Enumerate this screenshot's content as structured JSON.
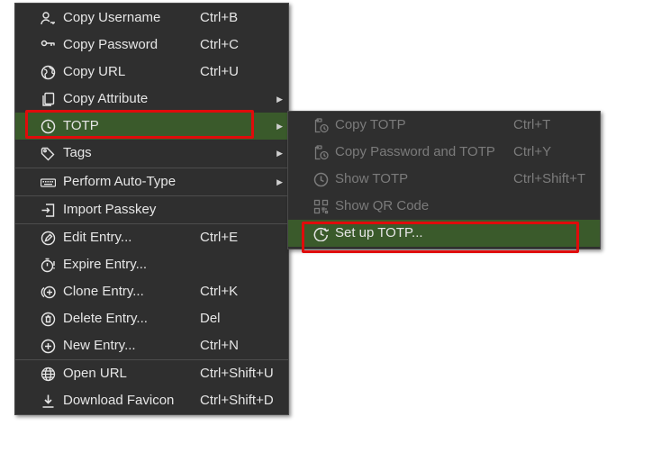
{
  "main_menu": {
    "items": [
      {
        "label": "Copy Username",
        "shortcut": "Ctrl+B",
        "icon": "user-key-icon"
      },
      {
        "label": "Copy Password",
        "shortcut": "Ctrl+C",
        "icon": "key-icon"
      },
      {
        "label": "Copy URL",
        "shortcut": "Ctrl+U",
        "icon": "globe-icon"
      },
      {
        "label": "Copy Attribute",
        "shortcut": "",
        "icon": "copy-icon"
      },
      {
        "label": "TOTP",
        "shortcut": "",
        "icon": "clock-icon"
      },
      {
        "label": "Tags",
        "shortcut": "",
        "icon": "tag-icon"
      },
      {
        "label": "Perform Auto-Type",
        "shortcut": "",
        "icon": "keyboard-icon"
      },
      {
        "label": "Import Passkey",
        "shortcut": "",
        "icon": "import-icon"
      },
      {
        "label": "Edit Entry...",
        "shortcut": "Ctrl+E",
        "icon": "edit-icon"
      },
      {
        "label": "Expire Entry...",
        "shortcut": "",
        "icon": "timer-icon"
      },
      {
        "label": "Clone Entry...",
        "shortcut": "Ctrl+K",
        "icon": "clone-icon"
      },
      {
        "label": "Delete Entry...",
        "shortcut": "Del",
        "icon": "delete-icon"
      },
      {
        "label": "New Entry...",
        "shortcut": "Ctrl+N",
        "icon": "plus-circle-icon"
      },
      {
        "label": "Open URL",
        "shortcut": "Ctrl+Shift+U",
        "icon": "world-icon"
      },
      {
        "label": "Download Favicon",
        "shortcut": "Ctrl+Shift+D",
        "icon": "download-icon"
      }
    ]
  },
  "totp_submenu": {
    "items": [
      {
        "label": "Copy TOTP",
        "shortcut": "Ctrl+T",
        "icon": "clipboard-clock-icon"
      },
      {
        "label": "Copy Password and TOTP",
        "shortcut": "Ctrl+Y",
        "icon": "clipboard-clock-icon"
      },
      {
        "label": "Show TOTP",
        "shortcut": "Ctrl+Shift+T",
        "icon": "clock-icon"
      },
      {
        "label": "Show QR Code",
        "shortcut": "",
        "icon": "qr-code-icon"
      },
      {
        "label": "Set up TOTP...",
        "shortcut": "",
        "icon": "clock-setup-icon"
      }
    ]
  },
  "colors": {
    "menu_bg": "#2f2f2f",
    "highlight": "#3a5a2b",
    "annotation": "#e00b0b",
    "disabled_text": "#7b7b7b"
  }
}
